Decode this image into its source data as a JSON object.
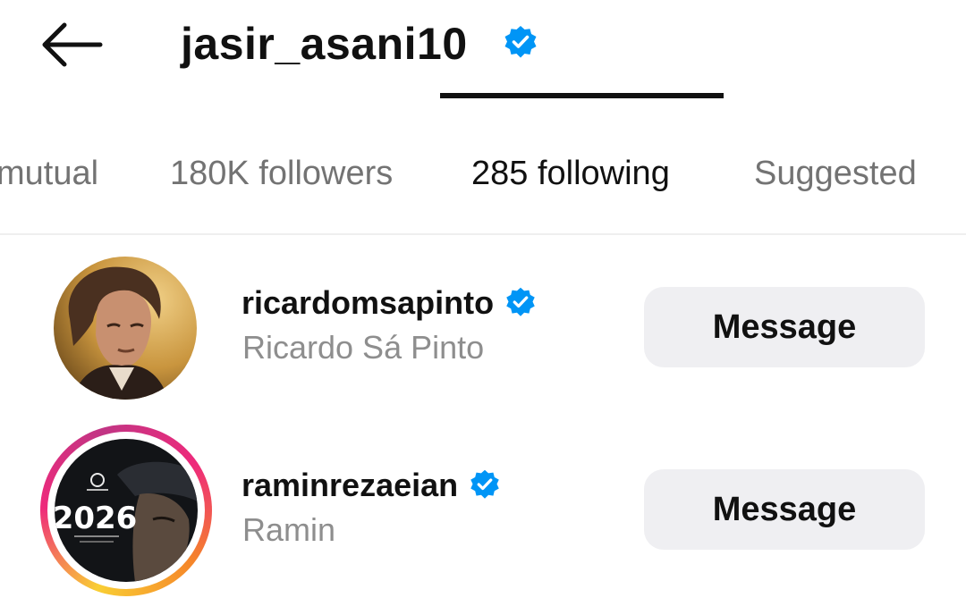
{
  "header": {
    "back_icon": "arrow-left-icon",
    "username": "jasir_asani10",
    "verified_icon": "verified-badge-icon"
  },
  "tabs": [
    {
      "label": "mutual",
      "active": false
    },
    {
      "label": "180K followers",
      "active": false
    },
    {
      "label": "285 following",
      "active": true
    },
    {
      "label": "Suggested",
      "active": false
    }
  ],
  "colors": {
    "verified_blue": "#0095f6",
    "tab_inactive": "#737373",
    "secondary_text": "#8e8e8e",
    "button_bg": "#efeff2"
  },
  "list": [
    {
      "username": "ricardomsapinto",
      "full_name": "Ricardo Sá Pinto",
      "verified": true,
      "has_story": false,
      "button_label": "Message"
    },
    {
      "username": "raminrezaeian",
      "full_name": "Ramin",
      "verified": true,
      "has_story": true,
      "avatar_text": "2026",
      "button_label": "Message"
    }
  ]
}
